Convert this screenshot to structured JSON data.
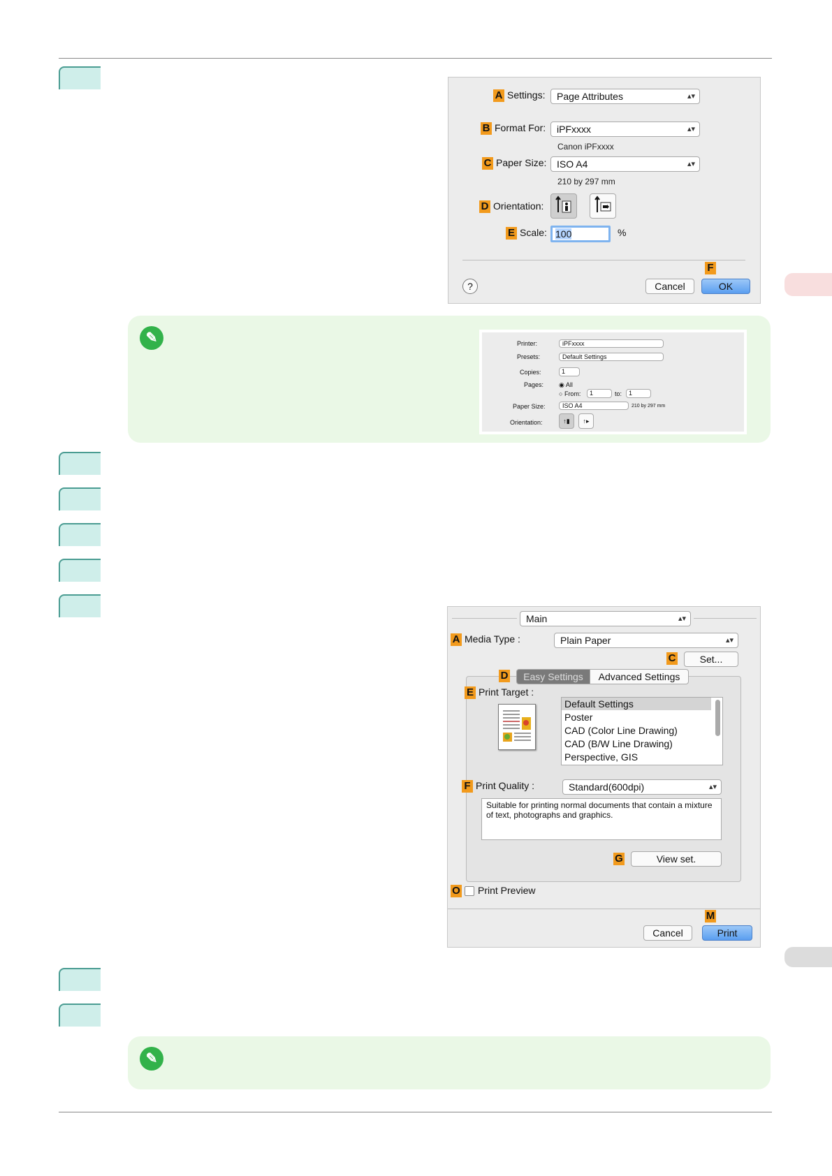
{
  "page": {
    "side_tab_top": "",
    "side_tab_bottom": ""
  },
  "dialog_page_setup": {
    "settings_label": "Settings:",
    "settings_value": "Page Attributes",
    "format_label": "Format For:",
    "format_value": "iPFxxxx",
    "format_sub": "Canon iPFxxxx",
    "paper_label": "Paper Size:",
    "paper_value": "ISO A4",
    "paper_sub": "210 by 297 mm",
    "orientation_label": "Orientation:",
    "scale_label": "Scale:",
    "scale_value": "100",
    "scale_unit": "%",
    "cancel": "Cancel",
    "ok": "OK",
    "help": "?",
    "markers": [
      "A",
      "B",
      "C",
      "D",
      "E",
      "F"
    ]
  },
  "note_dialog": {
    "printer_label": "Printer:",
    "printer_value": "iPFxxxx",
    "presets_label": "Presets:",
    "presets_value": "Default Settings",
    "copies_label": "Copies:",
    "copies_value": "1",
    "pages_label": "Pages:",
    "pages_all": "All",
    "pages_from": "From:",
    "from_value": "1",
    "to_label": "to:",
    "to_value": "1",
    "paper_label": "Paper Size:",
    "paper_value": "ISO A4",
    "paper_sub": "210 by 297 mm",
    "orientation_label": "Orientation:"
  },
  "dialog_main": {
    "panel": "Main",
    "media_label": "Media Type :",
    "media_value": "Plain Paper",
    "set_button": "Set...",
    "tab_easy": "Easy Settings",
    "tab_advanced": "Advanced Settings",
    "print_target_label": "Print Target :",
    "targets": [
      "Default Settings",
      "Poster",
      "CAD (Color Line Drawing)",
      "CAD (B/W Line Drawing)",
      "Perspective, GIS"
    ],
    "quality_label": "Print Quality :",
    "quality_value": "Standard(600dpi)",
    "description": "Suitable for printing normal documents that contain a mixture of text, photographs and graphics.",
    "view_set": "View set.",
    "preview_label": "Print Preview",
    "cancel": "Cancel",
    "print": "Print",
    "markers": [
      "A",
      "C",
      "D",
      "E",
      "F",
      "G",
      "O",
      "M"
    ]
  }
}
